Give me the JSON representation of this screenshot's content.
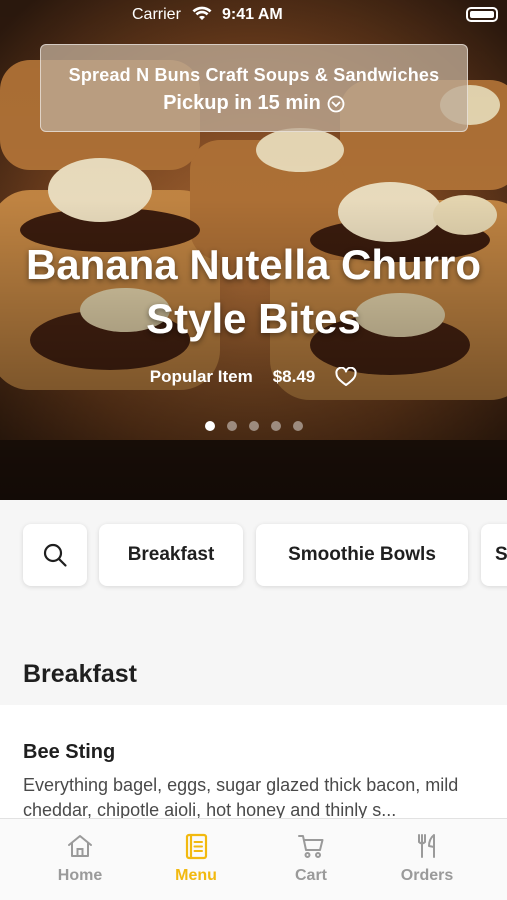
{
  "status_bar": {
    "carrier": "Carrier",
    "time": "9:41 AM"
  },
  "store": {
    "name": "Spread N Buns Craft Soups & Sandwiches",
    "pickup": "Pickup in 15 min"
  },
  "hero": {
    "title_line1": "Banana Nutella Churro",
    "title_line2": "Style Bites",
    "tag": "Popular Item",
    "price": "$8.49",
    "slide_count": 5,
    "active_slide": 1
  },
  "categories": {
    "items": [
      "Breakfast",
      "Smoothie Bowls",
      "S"
    ]
  },
  "section": {
    "title": "Breakfast",
    "items": [
      {
        "name": "Bee Sting",
        "description": "Everything bagel, eggs, sugar glazed thick bacon, mild cheddar, chipotle aioli, hot honey and thinly s..."
      }
    ]
  },
  "tabs": [
    {
      "label": "Home",
      "icon": "home-icon"
    },
    {
      "label": "Menu",
      "icon": "menu-book-icon",
      "active": true
    },
    {
      "label": "Cart",
      "icon": "cart-icon"
    },
    {
      "label": "Orders",
      "icon": "fork-knife-icon"
    }
  ],
  "colors": {
    "accent": "#f2b90f",
    "inactive_tab": "#9a9a9a",
    "hero_dark": "#3a2416"
  }
}
